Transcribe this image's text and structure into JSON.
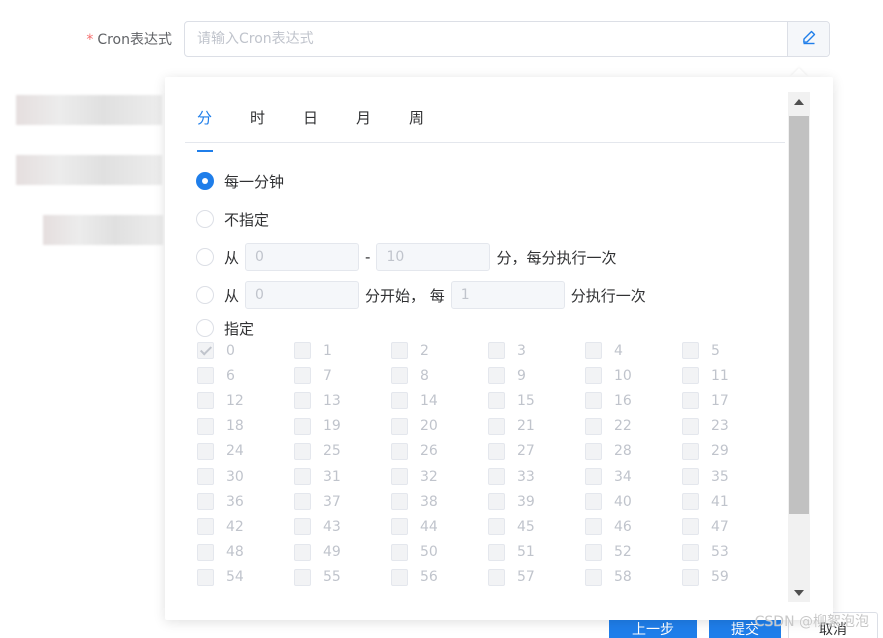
{
  "form": {
    "required_mark": "*",
    "label": "Cron表达式",
    "input_value": "",
    "input_placeholder": "请输入Cron表达式",
    "edit_icon": "pencil-icon"
  },
  "popover": {
    "tabs": [
      "分",
      "时",
      "日",
      "月",
      "周"
    ],
    "active_tab": "分",
    "options": {
      "every": "每一分钟",
      "unspecified": "不指定",
      "range": {
        "prefix": "从",
        "from": "0",
        "dash": "-",
        "to": "10",
        "suffix": "分，每分执行一次"
      },
      "step": {
        "prefix": "从",
        "start": "0",
        "mid": "分开始，  每",
        "every": "1",
        "suffix": "分执行一次"
      },
      "specify": "指定"
    },
    "selected_option": "every",
    "minutes": [
      "0",
      "1",
      "2",
      "3",
      "4",
      "5",
      "6",
      "7",
      "8",
      "9",
      "10",
      "11",
      "12",
      "13",
      "14",
      "15",
      "16",
      "17",
      "18",
      "19",
      "20",
      "21",
      "22",
      "23",
      "24",
      "25",
      "26",
      "27",
      "28",
      "29",
      "30",
      "31",
      "32",
      "33",
      "34",
      "35",
      "36",
      "37",
      "38",
      "39",
      "40",
      "41",
      "42",
      "43",
      "44",
      "45",
      "46",
      "47",
      "48",
      "49",
      "50",
      "51",
      "52",
      "53",
      "54",
      "55",
      "56",
      "57",
      "58",
      "59"
    ],
    "checked_minutes": [
      "0"
    ]
  },
  "buttons": {
    "prev": "上一步",
    "submit": "提交",
    "cancel": "取消"
  },
  "watermark": "CSDN @柳絮泡泡",
  "colors": {
    "primary": "#1f7eea",
    "required": "#f56c6c"
  }
}
